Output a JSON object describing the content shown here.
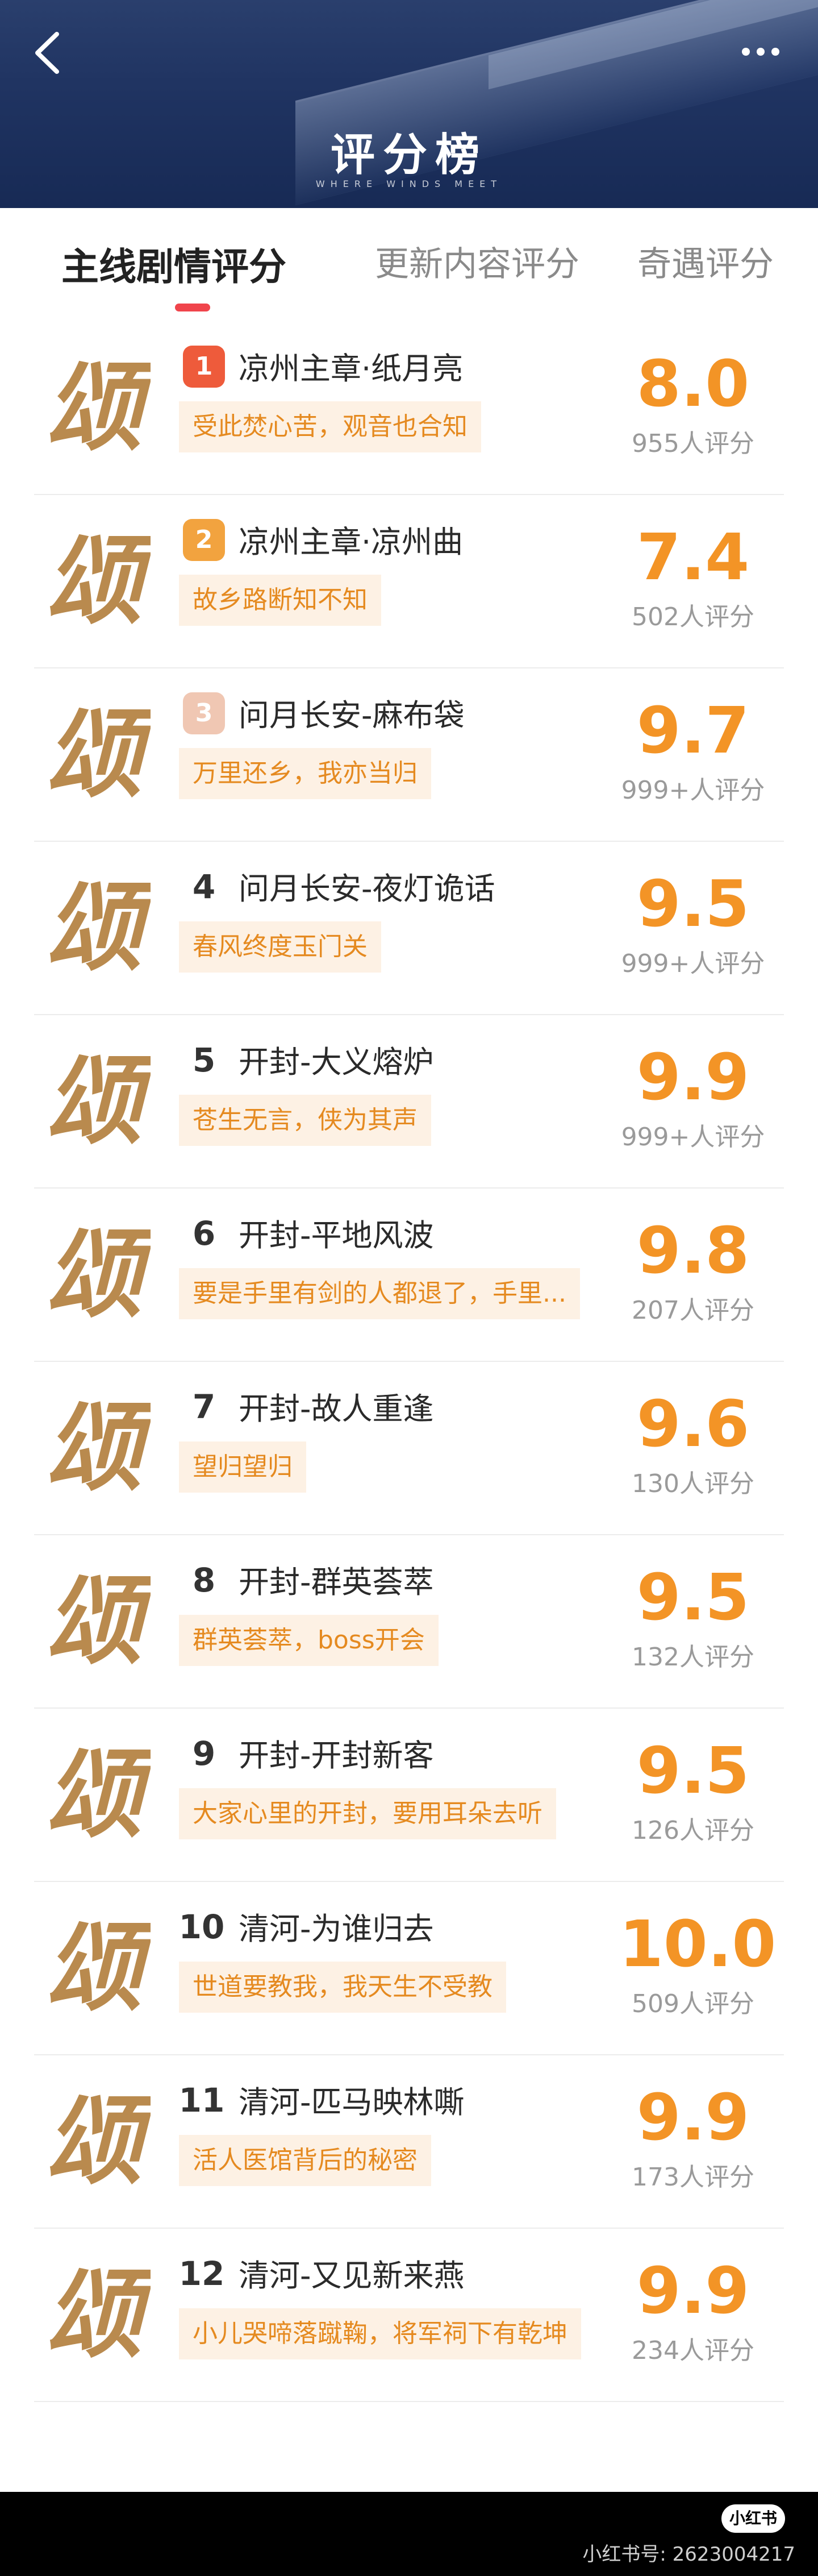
{
  "header": {
    "title": "评分榜",
    "subtitle": "WHERE WINDS MEET",
    "back_icon": "chevron-left-icon",
    "more_icon": "more-dots-icon"
  },
  "tabs": [
    {
      "label": "主线剧情评分",
      "active": true
    },
    {
      "label": "更新内容评分",
      "active": false
    },
    {
      "label": "奇遇评分",
      "active": false
    }
  ],
  "list": [
    {
      "rank": "1",
      "title": "凉州主章·纸月亮",
      "quote": "受此焚心苦，观音也合知",
      "score": "8.0",
      "count": "955人评分"
    },
    {
      "rank": "2",
      "title": "凉州主章·凉州曲",
      "quote": "故乡路断知不知",
      "score": "7.4",
      "count": "502人评分"
    },
    {
      "rank": "3",
      "title": "问月长安-麻布袋",
      "quote": "万里还乡，我亦当归",
      "score": "9.7",
      "count": "999+人评分"
    },
    {
      "rank": "4",
      "title": "问月长安-夜灯诡话",
      "quote": "春风终度玉门关",
      "score": "9.5",
      "count": "999+人评分"
    },
    {
      "rank": "5",
      "title": "开封-大义熔炉",
      "quote": "苍生无言，侠为其声",
      "score": "9.9",
      "count": "999+人评分"
    },
    {
      "rank": "6",
      "title": "开封-平地风波",
      "quote": "要是手里有剑的人都退了，手里...",
      "score": "9.8",
      "count": "207人评分"
    },
    {
      "rank": "7",
      "title": "开封-故人重逢",
      "quote": "望归望归",
      "score": "9.6",
      "count": "130人评分"
    },
    {
      "rank": "8",
      "title": "开封-群英荟萃",
      "quote": "群英荟萃，boss开会",
      "score": "9.5",
      "count": "132人评分"
    },
    {
      "rank": "9",
      "title": "开封-开封新客",
      "quote": "大家心里的开封，要用耳朵去听",
      "score": "9.5",
      "count": "126人评分"
    },
    {
      "rank": "10",
      "title": "清河-为谁归去",
      "quote": "世道要教我，我天生不受教",
      "score": "10.0",
      "count": "509人评分"
    },
    {
      "rank": "11",
      "title": "清河-匹马映林嘶",
      "quote": "活人医馆背后的秘密",
      "score": "9.9",
      "count": "173人评分"
    },
    {
      "rank": "12",
      "title": "清河-又见新来燕",
      "quote": "小儿哭啼落蹴鞠，将军祠下有乾坤",
      "score": "9.9",
      "count": "234人评分"
    }
  ],
  "colors": {
    "score": "#f39426",
    "quote_text": "#e58a20",
    "quote_bg": "#fdf1e4",
    "tab_indicator": "#f0444b",
    "seal_gold": "#b98a4e"
  },
  "seal_glyph": "颂",
  "footer": {
    "logo": "小红书",
    "text": "小红书号: 2623004217"
  }
}
